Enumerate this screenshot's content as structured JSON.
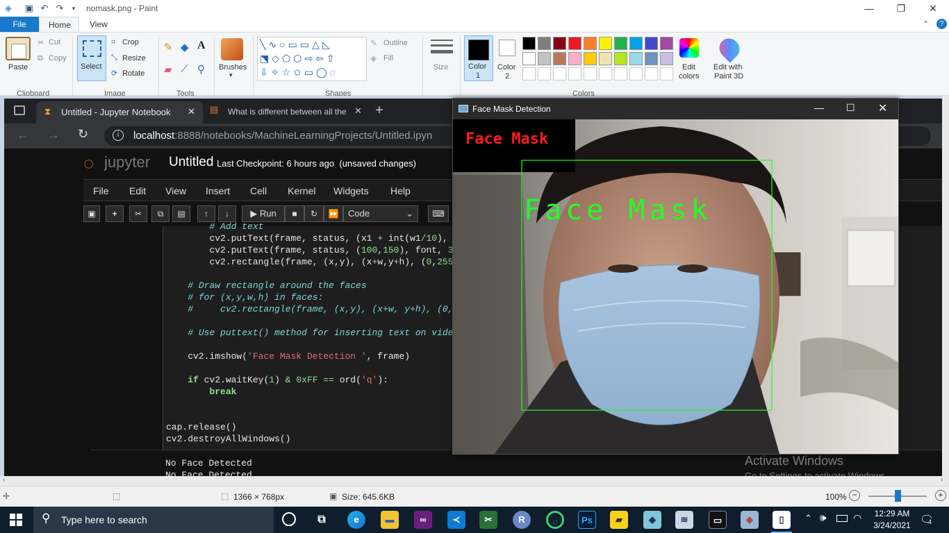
{
  "paint": {
    "window_title": "nomask.png - Paint",
    "tabs": {
      "file": "File",
      "home": "Home",
      "view": "View"
    },
    "clipboard": {
      "paste": "Paste",
      "cut": "Cut",
      "copy": "Copy",
      "group": "Clipboard"
    },
    "image": {
      "select": "Select",
      "crop": "Crop",
      "resize": "Resize",
      "rotate": "Rotate",
      "group": "Image"
    },
    "tools": {
      "group": "Tools",
      "text_tool": "A"
    },
    "brushes": "Brushes",
    "shapes": {
      "outline": "Outline",
      "fill": "Fill",
      "group": "Shapes"
    },
    "size": "Size",
    "colors": {
      "color1": "Color\n1",
      "color1_a": "Color",
      "color1_b": "1",
      "color2_a": "Color",
      "color2_b": "2",
      "edit_a": "Edit",
      "edit_b": "colors",
      "paint3d_a": "Edit with",
      "paint3d_b": "Paint 3D",
      "group": "Colors",
      "palette_row1": [
        "#000000",
        "#7f7f7f",
        "#880015",
        "#ed1c24",
        "#ff7f27",
        "#fff200",
        "#22b14c",
        "#00a2e8",
        "#3f48cc",
        "#a349a4"
      ],
      "palette_row2": [
        "#ffffff",
        "#c3c3c3",
        "#b97a57",
        "#ffaec9",
        "#ffc90e",
        "#efe4b0",
        "#b5e61d",
        "#99d9ea",
        "#7092be",
        "#c8bfe7"
      ]
    },
    "status": {
      "dimensions": "1366 × 768px",
      "size": "Size: 645.6KB",
      "zoom": "100%"
    }
  },
  "browser": {
    "tab1": "Untitled - Jupyter Notebook",
    "tab2": "What is different between all the",
    "url_host": "localhost",
    "url_rest": ":8888/notebooks/MachineLearningProjects/Untitled.ipyn"
  },
  "jupyter": {
    "logo": "jupyter",
    "notebook_name": "Untitled",
    "checkpoint": "Last Checkpoint: 6 hours ago",
    "unsaved": "(unsaved changes)",
    "menu": [
      "File",
      "Edit",
      "View",
      "Insert",
      "Cell",
      "Kernel",
      "Widgets",
      "Help"
    ],
    "run": "Run",
    "cell_type": "Code",
    "output": [
      "No Face Detected",
      "No Face Detected"
    ]
  },
  "cv_window": {
    "title": "Face Mask Detection",
    "label_top": "Face Mask",
    "label_box": "Face Mask"
  },
  "watermark": {
    "line1": "Activate Windows",
    "line2": "Go to Settings to activate Windows."
  },
  "taskbar": {
    "search": "Type here to search",
    "time": "12:29 AM",
    "date": "3/24/2021",
    "notifications": "4"
  }
}
